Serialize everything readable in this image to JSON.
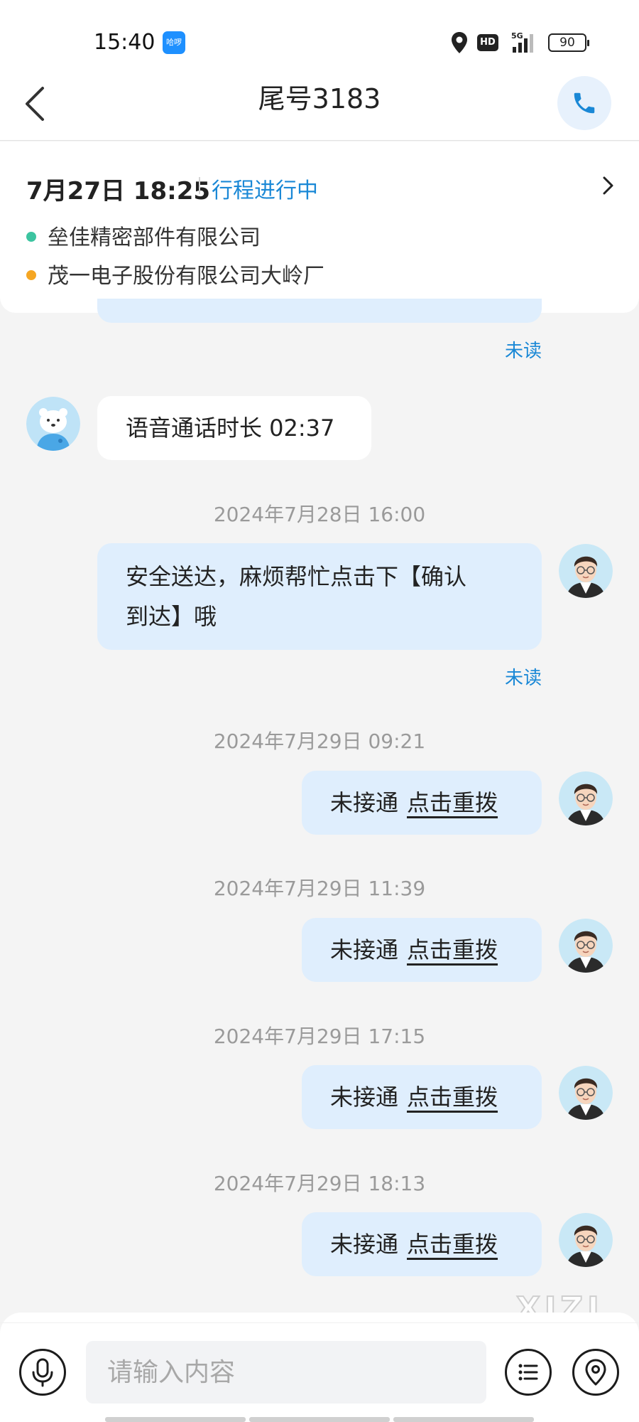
{
  "status_bar": {
    "time": "15:40",
    "app_badge": "哈啰",
    "battery": "90",
    "network": "5G",
    "hd": "HD"
  },
  "header": {
    "title": "尾号3183"
  },
  "trip": {
    "datetime": "7月27日 18:25",
    "status": "行程进行中",
    "pickup": "垒佳精密部件有限公司",
    "dropoff": "茂一电子股份有限公司大岭厂",
    "pickup_color": "#3cc4a0",
    "dropoff_color": "#f5a623"
  },
  "chat": {
    "unread_1": "未读",
    "call_duration": "语音通话时长 02:37",
    "ts_1": "2024年7月28日 16:00",
    "arrival_line1": "安全送达，麻烦帮忙点击下【确认",
    "arrival_line2": "到达】哦",
    "unread_2": "未读",
    "missed": [
      {
        "time": "2024年7月29日 09:21",
        "text": "未接通",
        "action": "点击重拨"
      },
      {
        "time": "2024年7月29日 11:39",
        "text": "未接通",
        "action": "点击重拨"
      },
      {
        "time": "2024年7月29日 17:15",
        "text": "未接通",
        "action": "点击重拨"
      },
      {
        "time": "2024年7月29日 18:13",
        "text": "未接通",
        "action": "点击重拨"
      }
    ]
  },
  "watermark": "XIZI",
  "input": {
    "placeholder": "请输入内容"
  },
  "icons": {
    "back": "chevron-left-icon",
    "call": "phone-icon",
    "voice": "microphone-icon",
    "menu": "list-icon",
    "location": "location-pin-icon",
    "passenger_avatar": "polar-bear-avatar",
    "driver_avatar": "man-with-glasses-avatar"
  },
  "colors": {
    "accent": "#1a88d6",
    "my_bubble": "#dfeefd",
    "background": "#f4f4f4"
  }
}
